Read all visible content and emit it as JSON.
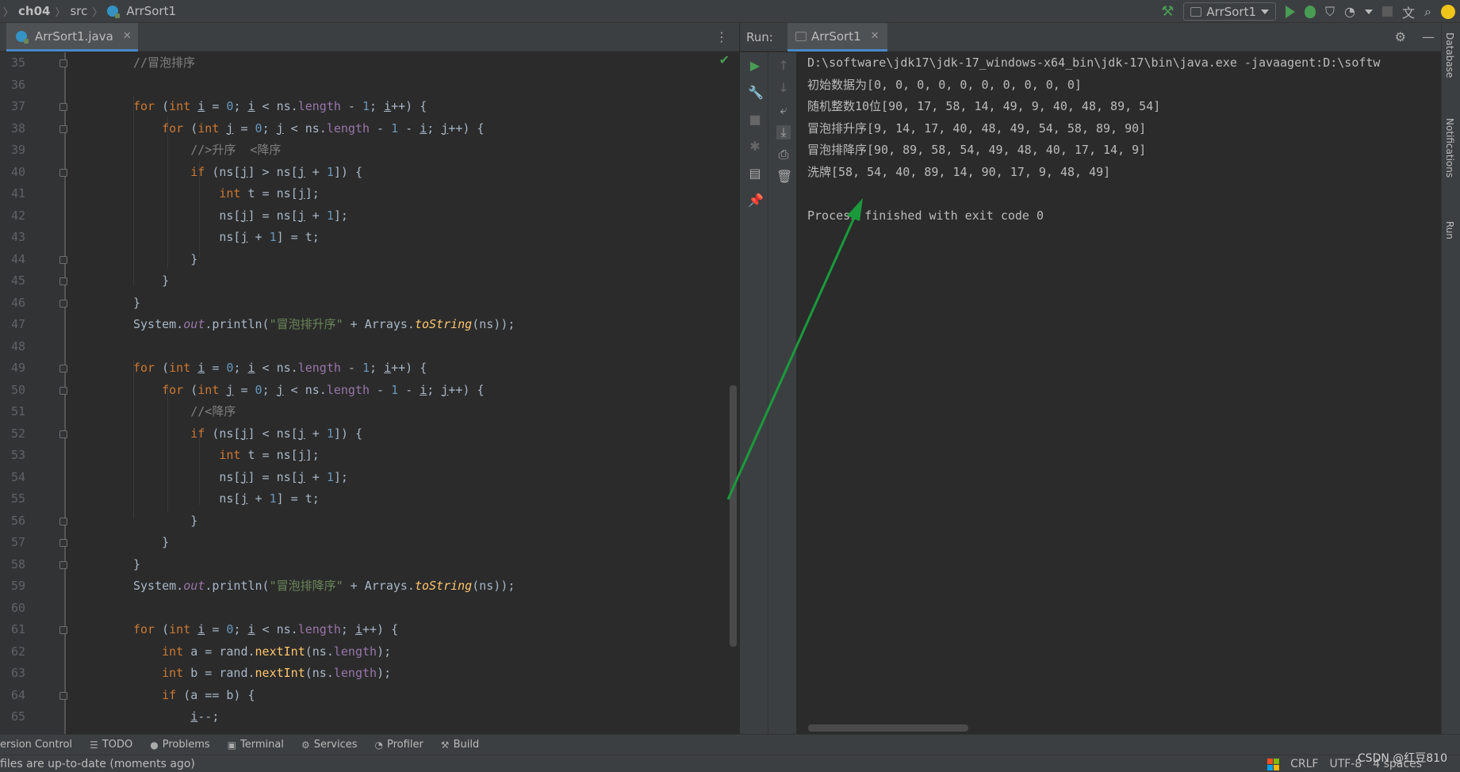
{
  "breadcrumb": {
    "project": "ch04",
    "folder": "src",
    "file": "ArrSort1"
  },
  "toolbar": {
    "run_config": "ArrSort1"
  },
  "editor": {
    "tab_label": "ArrSort1.java"
  },
  "run_panel": {
    "title": "Run:",
    "tab_label": "ArrSort1",
    "console": [
      "D:\\software\\jdk17\\jdk-17_windows-x64_bin\\jdk-17\\bin\\java.exe -javaagent:D:\\softw",
      "初始数据为[0, 0, 0, 0, 0, 0, 0, 0, 0, 0]",
      "随机整数10位[90, 17, 58, 14, 49, 9, 40, 48, 89, 54]",
      "冒泡排升序[9, 14, 17, 40, 48, 49, 54, 58, 89, 90]",
      "冒泡排降序[90, 89, 58, 54, 49, 48, 40, 17, 14, 9]",
      "洗牌[58, 54, 40, 89, 14, 90, 17, 9, 48, 49]",
      "",
      "Process finished with exit code 0"
    ]
  },
  "right_strip": {
    "database": "Database",
    "notifications": "Notifications",
    "run": "Run"
  },
  "bottom_tools": {
    "version_control": "ersion Control",
    "todo": "TODO",
    "problems": "Problems",
    "terminal": "Terminal",
    "services": "Services",
    "profiler": "Profiler",
    "build": "Build"
  },
  "status": {
    "message": "files are up-to-date (moments ago)",
    "line_sep": "CRLF",
    "encoding": "UTF-8",
    "indent": "4 spaces"
  },
  "watermark": "CSDN @红豆810",
  "colors": {
    "accent": "#4a88c7",
    "run_green": "#499c54",
    "arrow_green": "#1a9a3c"
  }
}
